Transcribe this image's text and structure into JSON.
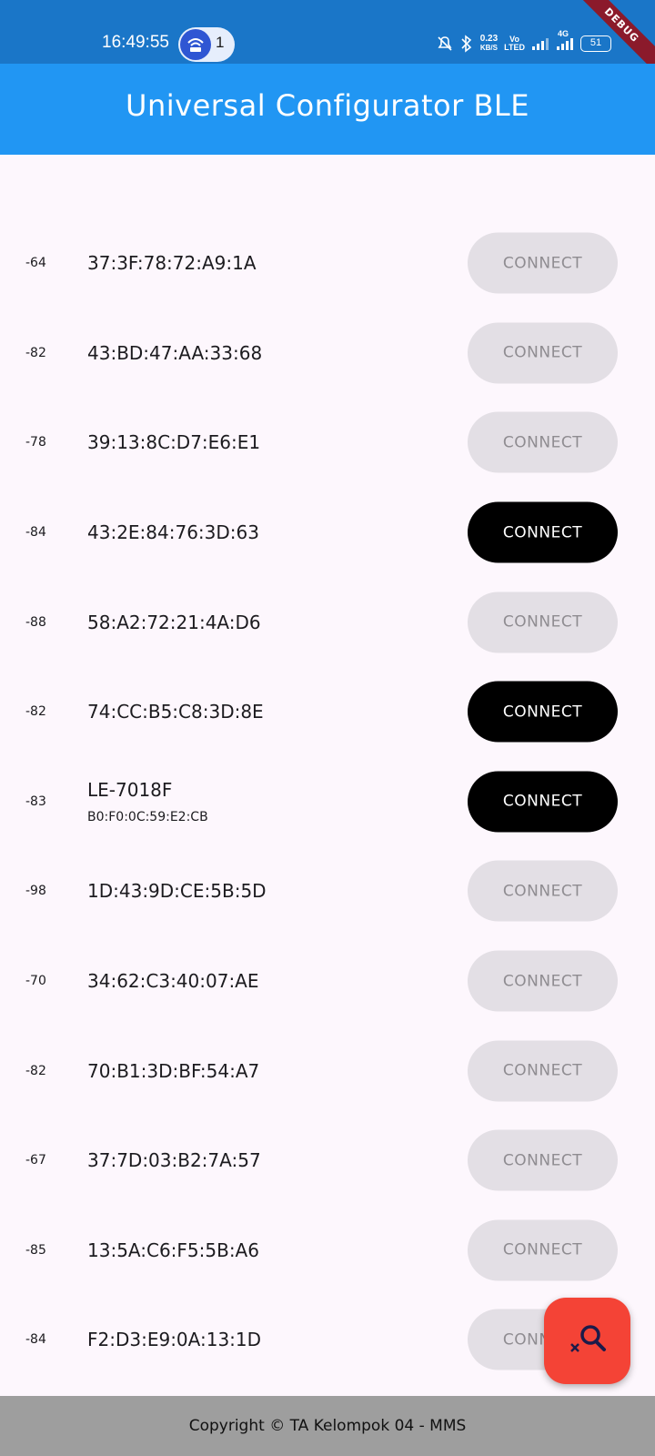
{
  "status_bar": {
    "time": "16:49:55",
    "hotspot_count": "1",
    "net_speed_value": "0.23",
    "net_speed_unit": "KB/S",
    "volte_top": "Vo",
    "volte_bottom": "LTED",
    "network_type": "4G",
    "battery": "51",
    "debug_label": "DEBUG"
  },
  "app_bar": {
    "title": "Universal Configurator BLE"
  },
  "devices": [
    {
      "rssi": "-64",
      "name": "37:3F:78:72:A9:1A",
      "sub": "",
      "button": "CONNECT",
      "enabled": false
    },
    {
      "rssi": "-82",
      "name": "43:BD:47:AA:33:68",
      "sub": "",
      "button": "CONNECT",
      "enabled": false
    },
    {
      "rssi": "-78",
      "name": "39:13:8C:D7:E6:E1",
      "sub": "",
      "button": "CONNECT",
      "enabled": false
    },
    {
      "rssi": "-84",
      "name": "43:2E:84:76:3D:63",
      "sub": "",
      "button": "CONNECT",
      "enabled": true
    },
    {
      "rssi": "-88",
      "name": "58:A2:72:21:4A:D6",
      "sub": "",
      "button": "CONNECT",
      "enabled": false
    },
    {
      "rssi": "-82",
      "name": "74:CC:B5:C8:3D:8E",
      "sub": "",
      "button": "CONNECT",
      "enabled": true
    },
    {
      "rssi": "-83",
      "name": "LE-7018F",
      "sub": "B0:F0:0C:59:E2:CB",
      "button": "CONNECT",
      "enabled": true
    },
    {
      "rssi": "-98",
      "name": "1D:43:9D:CE:5B:5D",
      "sub": "",
      "button": "CONNECT",
      "enabled": false
    },
    {
      "rssi": "-70",
      "name": "34:62:C3:40:07:AE",
      "sub": "",
      "button": "CONNECT",
      "enabled": false
    },
    {
      "rssi": "-82",
      "name": "70:B1:3D:BF:54:A7",
      "sub": "",
      "button": "CONNECT",
      "enabled": false
    },
    {
      "rssi": "-67",
      "name": "37:7D:03:B2:7A:57",
      "sub": "",
      "button": "CONNECT",
      "enabled": false
    },
    {
      "rssi": "-85",
      "name": "13:5A:C6:F5:5B:A6",
      "sub": "",
      "button": "CONNECT",
      "enabled": false
    },
    {
      "rssi": "-84",
      "name": "F2:D3:E9:0A:13:1D",
      "sub": "",
      "button": "CONNECT",
      "enabled": false
    }
  ],
  "fab": {
    "icon": "search-off-icon",
    "color": "#f44336"
  },
  "footer": {
    "text": "Copyright © TA Kelompok 04 - MMS"
  },
  "colors": {
    "status_bar": "#1a76c8",
    "app_bar": "#2196f3",
    "background": "#fdf7fd",
    "button_disabled_bg": "#e3dfe5",
    "button_disabled_text": "#8f8c91",
    "button_enabled_bg": "#000000",
    "footer_bg": "#9e9e9e"
  }
}
